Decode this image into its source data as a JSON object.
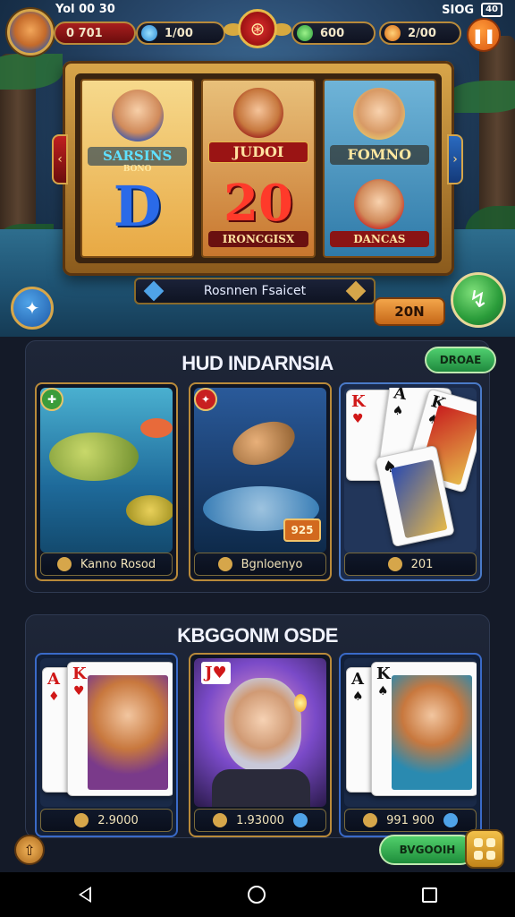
{
  "status_bar": {
    "time": "Yol 00 30",
    "signal": "SIOG",
    "battery": "40"
  },
  "currency": {
    "lives": "0 701",
    "gems": "1/00",
    "cash": "600",
    "coins": "2/00"
  },
  "slot": {
    "reel1": {
      "label_top": "SARSINS",
      "label_sub": "BONO",
      "big": "D"
    },
    "reel2": {
      "label_top": "JUDOI",
      "big": "20",
      "label_bottom": "IRONCGISX"
    },
    "reel3": {
      "label_top": "FOMNO",
      "label_bottom": "DANCAS"
    }
  },
  "jackpot_strip": {
    "text": "Rosnnen Fsaicet"
  },
  "bet_button": {
    "label": "20N"
  },
  "section1": {
    "title": "HUD INDARNSIA",
    "more_label": "DROAE",
    "cards": [
      {
        "name": "Kanno Rosod"
      },
      {
        "name": "Bgnloenyo",
        "badge": "925"
      },
      {
        "name": "201"
      }
    ]
  },
  "section2": {
    "title": "KBGGONM OSDE",
    "cards": [
      {
        "value": "2.9000"
      },
      {
        "value": "1.93000"
      },
      {
        "value": "991 900"
      }
    ]
  },
  "bottom": {
    "green_label": "BVGOOIH"
  },
  "colors": {
    "gold_border": "#b98a3a",
    "green_accent": "#2a9c3a",
    "orange_accent": "#d9560f",
    "panel_bg": "#161c2b"
  }
}
